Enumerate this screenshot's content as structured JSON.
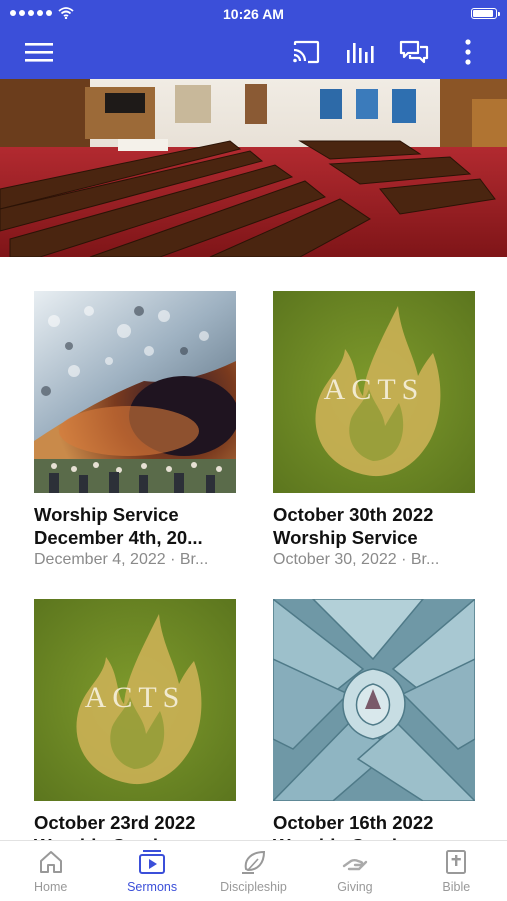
{
  "status_bar": {
    "time": "10:26 AM"
  },
  "header": {
    "menu_icon": "hamburger-menu-icon",
    "actions": [
      "cast-icon",
      "audio-bars-icon",
      "chat-icon",
      "more-vertical-icon"
    ]
  },
  "hero": {
    "description": "church sanctuary with wooden pews"
  },
  "sermons": [
    {
      "title_line1": "Worship Service",
      "title_line2": "December 4th, 20...",
      "subtitle": "December 4, 2022 · Br...",
      "artwork": "crowd-storm-painting"
    },
    {
      "title_line1": "October 30th 2022",
      "title_line2": "Worship Service",
      "subtitle": "October 30, 2022 · Br...",
      "artwork": "acts-flame",
      "artwork_text": "ACTS"
    },
    {
      "title_line1": "October 23rd 2022",
      "title_line2": "Worship Service",
      "artwork": "acts-flame",
      "artwork_text": "ACTS"
    },
    {
      "title_line1": "October 16th 2022",
      "title_line2": "Worship Service",
      "artwork": "agave-plant"
    }
  ],
  "tabs": [
    {
      "label": "Home",
      "icon": "home-icon",
      "active": false
    },
    {
      "label": "Sermons",
      "icon": "video-play-icon",
      "active": true
    },
    {
      "label": "Discipleship",
      "icon": "leaf-hand-icon",
      "active": false
    },
    {
      "label": "Giving",
      "icon": "giving-hand-icon",
      "active": false
    },
    {
      "label": "Bible",
      "icon": "bible-cross-icon",
      "active": false
    }
  ],
  "colors": {
    "header_bg": "#3b4fd9",
    "active_tab": "#3b4fd9",
    "inactive_tab": "#999999",
    "acts_green": "#6f8a25",
    "acts_flame": "#cdb257"
  }
}
